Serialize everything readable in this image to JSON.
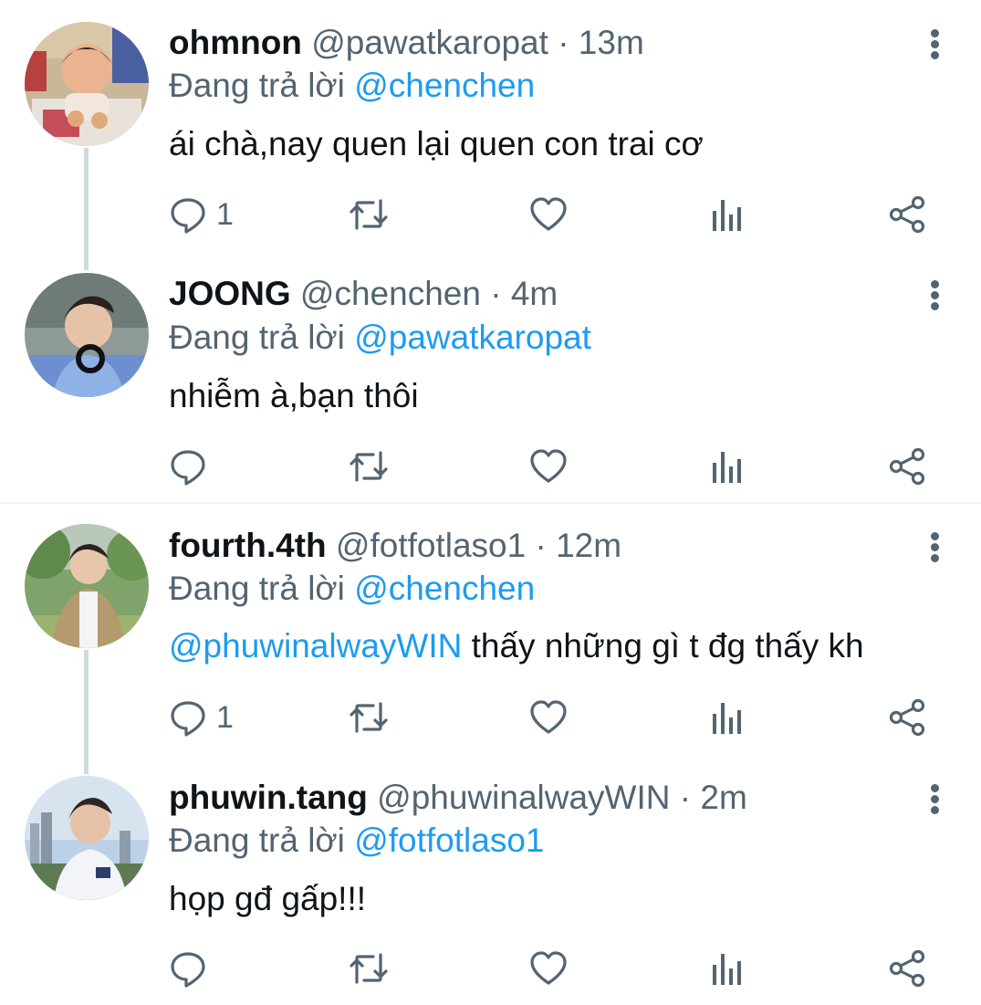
{
  "colors": {
    "link": "#1d9bf0",
    "secondary": "#536471",
    "text": "#0f1419",
    "thread_line": "#cfd9de"
  },
  "replying_label": "Đang trả lời",
  "tweets": [
    {
      "name": "ohmnon",
      "handle": "@pawatkaropat",
      "separator": "·",
      "time": "13m",
      "reply_to": "@chenchen",
      "text_mention": "",
      "text": "ái chà,nay quen lại quen con trai cơ",
      "reply_count": "1",
      "avatar_icon": "toddler-photo-avatar"
    },
    {
      "name": "JOONG",
      "handle": "@chenchen",
      "separator": "·",
      "time": "4m",
      "reply_to": "@pawatkaropat",
      "text_mention": "",
      "text": "nhiễm à,bạn thôi",
      "reply_count": "",
      "avatar_icon": "man-headphones-avatar"
    },
    {
      "name": "fourth.4th",
      "handle": "@fotfotlaso1",
      "separator": "·",
      "time": "12m",
      "reply_to": "@chenchen",
      "text_mention": "@phuwinalwayWIN",
      "text": "thấy những gì t đg thấy kh",
      "reply_count": "1",
      "avatar_icon": "man-outdoors-avatar"
    },
    {
      "name": "phuwin.tang",
      "handle": "@phuwinalwayWIN",
      "separator": "·",
      "time": "2m",
      "reply_to": "@fotfotlaso1",
      "text_mention": "",
      "text": "họp gđ gấp!!!",
      "reply_count": "",
      "avatar_icon": "man-city-skyline-avatar"
    }
  ]
}
